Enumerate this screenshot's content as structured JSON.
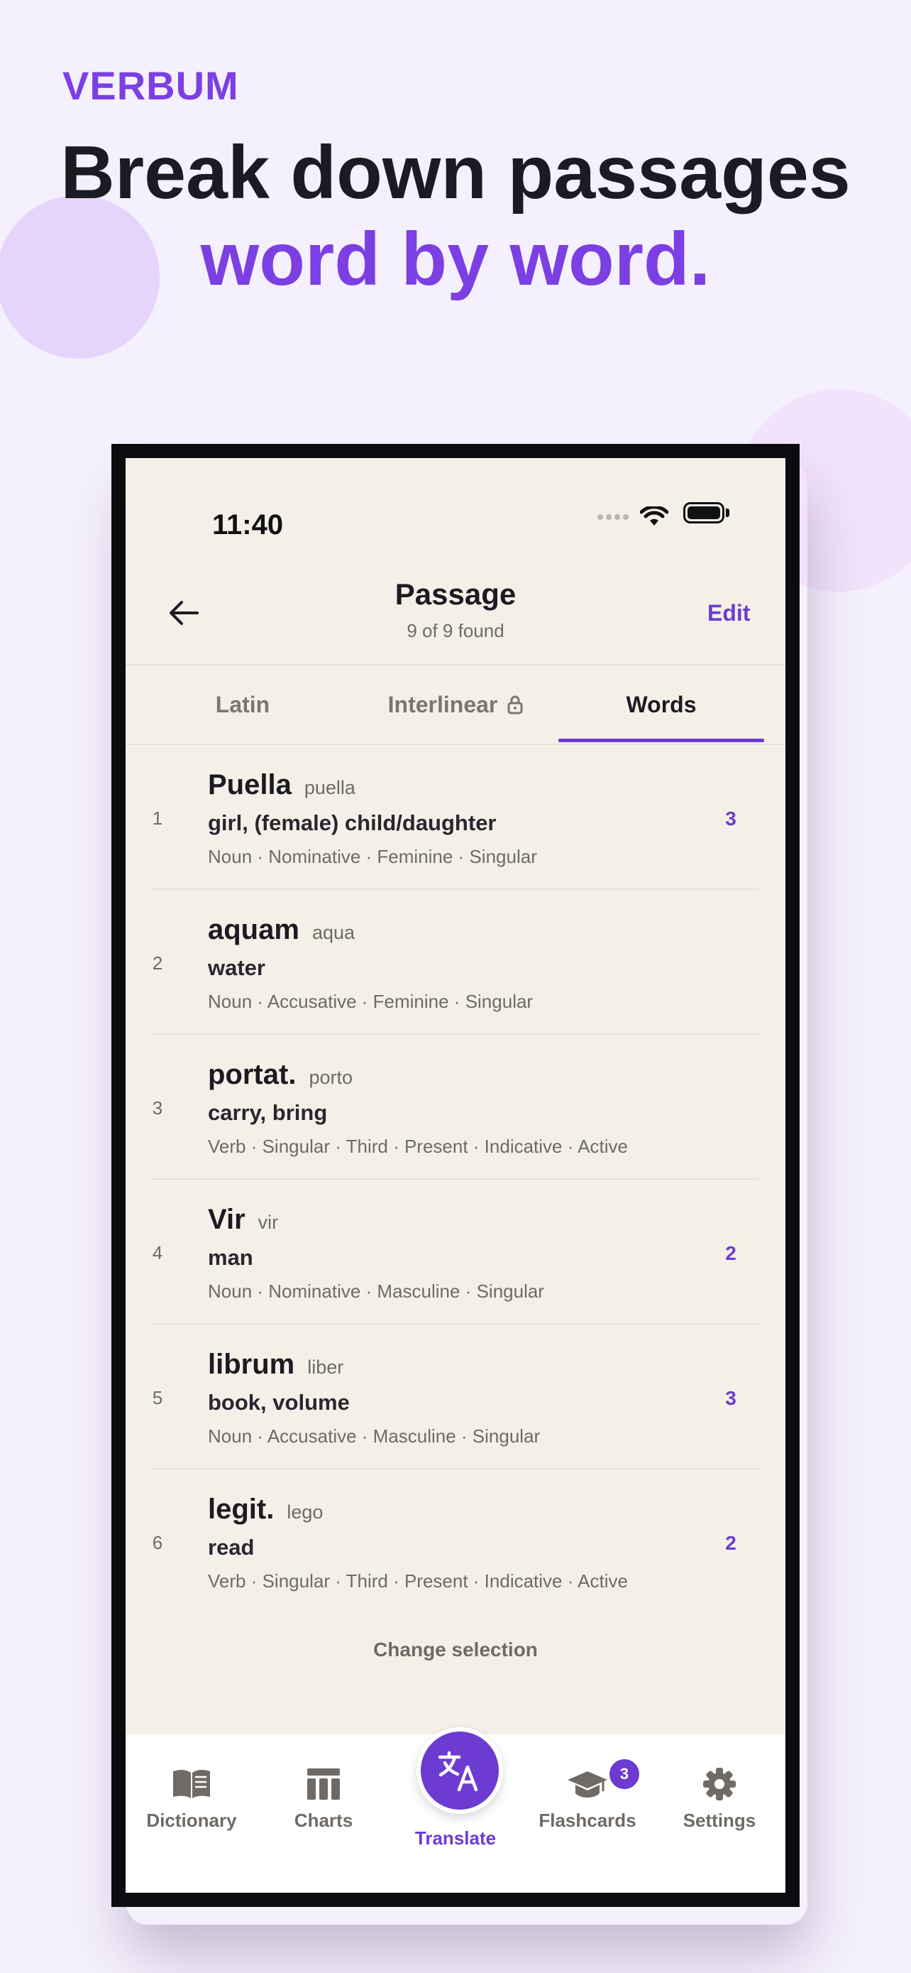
{
  "promo": {
    "brand": "VERBUM",
    "headline_line1": "Break down passages",
    "headline_line2": "word by word."
  },
  "status_bar": {
    "time": "11:40"
  },
  "nav": {
    "title": "Passage",
    "subtitle": "9 of 9 found",
    "edit_label": "Edit"
  },
  "tabs": [
    {
      "label": "Latin"
    },
    {
      "label": "Interlinear"
    },
    {
      "label": "Words",
      "selected": true
    }
  ],
  "words": [
    {
      "index": "1",
      "form": "Puella",
      "lemma": "puella",
      "meaning": "girl, (female) child/daughter",
      "tags": "Noun · Nominative · Feminine · Singular",
      "count": "3"
    },
    {
      "index": "2",
      "form": "aquam",
      "lemma": "aqua",
      "meaning": "water",
      "tags": "Noun · Accusative · Feminine · Singular",
      "count": ""
    },
    {
      "index": "3",
      "form": "portat.",
      "lemma": "porto",
      "meaning": "carry, bring",
      "tags": "Verb · Singular · Third · Present · Indicative · Active",
      "count": ""
    },
    {
      "index": "4",
      "form": "Vir",
      "lemma": "vir",
      "meaning": "man",
      "tags": "Noun · Nominative · Masculine · Singular",
      "count": "2"
    },
    {
      "index": "5",
      "form": "librum",
      "lemma": "liber",
      "meaning": "book, volume",
      "tags": "Noun · Accusative · Masculine · Singular",
      "count": "3"
    },
    {
      "index": "6",
      "form": "legit.",
      "lemma": "lego",
      "meaning": "read",
      "tags": "Verb · Singular · Third · Present · Indicative · Active",
      "count": "2"
    }
  ],
  "change_selection_label": "Change selection",
  "tabbar": {
    "dictionary": "Dictionary",
    "charts": "Charts",
    "translate": "Translate",
    "flashcards": "Flashcards",
    "flashcards_badge": "3",
    "settings": "Settings"
  },
  "colors": {
    "accent": "#6c3bd1",
    "brand": "#7b3fe4",
    "background": "#f5f0fd",
    "screen": "#f5f0e7"
  }
}
